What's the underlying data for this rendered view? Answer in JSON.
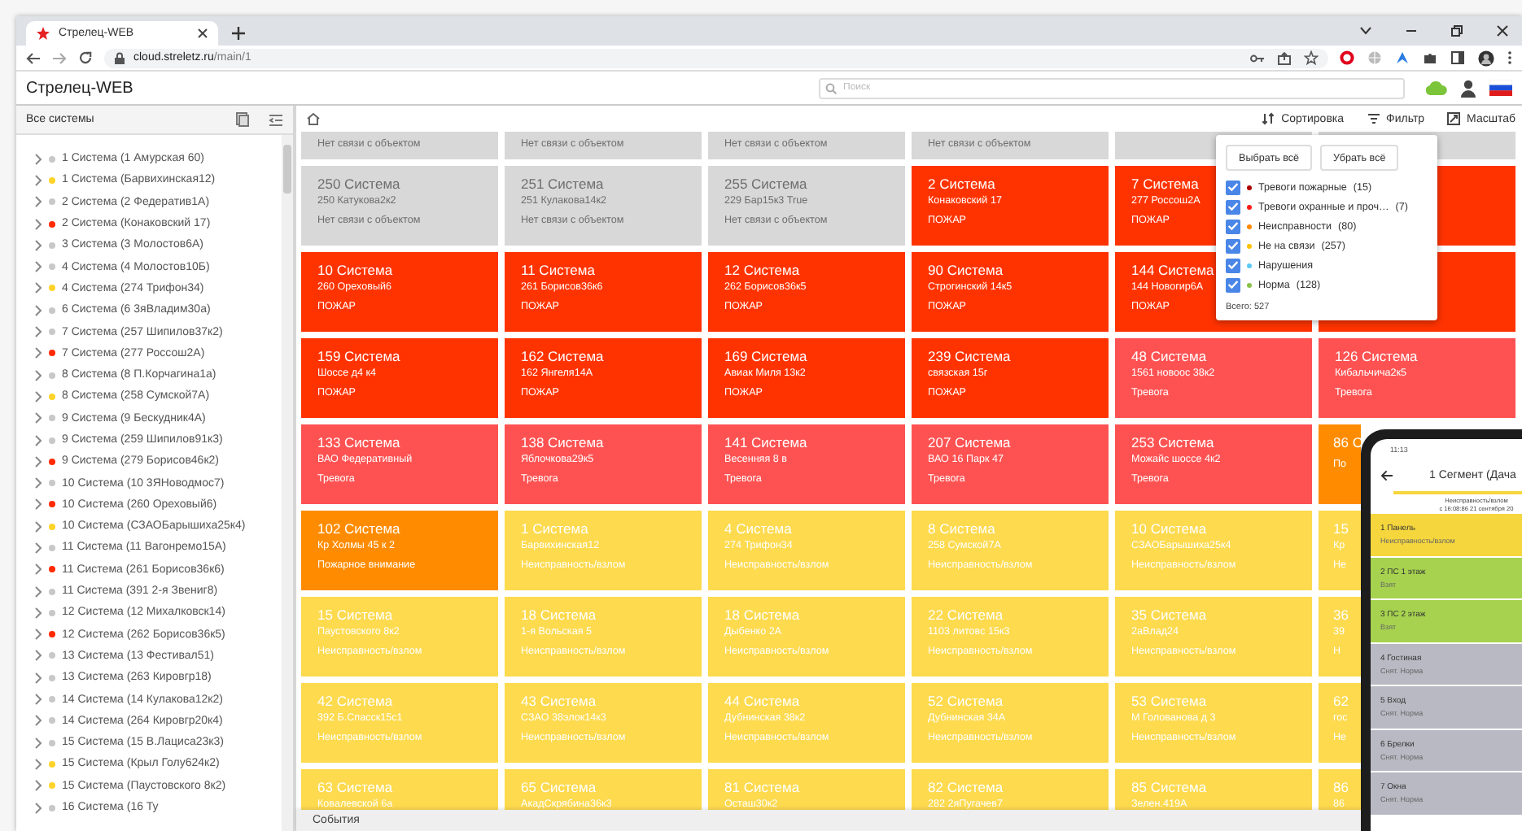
{
  "browser": {
    "tab_title": "Стрелец-WEB",
    "url_host": "cloud.streletz.ru",
    "url_path": "/main/1"
  },
  "app": {
    "title": "Стрелец-WEB",
    "search": {
      "placeholder": "Поиск"
    }
  },
  "sidebar": {
    "title": "Все системы",
    "items": [
      {
        "label": "1 Система (1 Амурская 60)",
        "color": "#c8c8c8"
      },
      {
        "label": "1 Система (Барвихинская12)",
        "color": "#ffd42a"
      },
      {
        "label": "2 Система (2 Федератив1А)",
        "color": "#c8c8c8"
      },
      {
        "label": "2 Система (Конаковский 17)",
        "color": "#ff2a00"
      },
      {
        "label": "3 Система (3 Молостов6А)",
        "color": "#c8c8c8"
      },
      {
        "label": "4 Система (4 Молостов10Б)",
        "color": "#c8c8c8"
      },
      {
        "label": "4 Система (274 Трифон34)",
        "color": "#ffd42a"
      },
      {
        "label": "6 Система (6 3яВладим30а)",
        "color": "#c8c8c8"
      },
      {
        "label": "7 Система (257 Шипилов37к2)",
        "color": "#c8c8c8"
      },
      {
        "label": "7 Система (277 Россош2А)",
        "color": "#ff2a00"
      },
      {
        "label": "8 Система (8 П.Корчагина1а)",
        "color": "#c8c8c8"
      },
      {
        "label": "8 Система (258 Сумской7А)",
        "color": "#ffd42a"
      },
      {
        "label": "9 Система (9 Бескудник4А)",
        "color": "#c8c8c8"
      },
      {
        "label": "9 Система (259 Шипилов91к3)",
        "color": "#c8c8c8"
      },
      {
        "label": "9 Система (279 Борисов46к2)",
        "color": "#ff2a00"
      },
      {
        "label": "10 Система (10 3ЯНоводмос7)",
        "color": "#c8c8c8"
      },
      {
        "label": "10 Система (260 Ореховый6)",
        "color": "#ff2a00"
      },
      {
        "label": "10 Система (СЗАОБарышиха25к4)",
        "color": "#ffd42a"
      },
      {
        "label": "11 Система (11 Вагонремо15А)",
        "color": "#c8c8c8"
      },
      {
        "label": "11 Система (261 Борисов36к6)",
        "color": "#ff2a00"
      },
      {
        "label": "11 Система (391 2-я Звениг8)",
        "color": "#c8c8c8"
      },
      {
        "label": "12 Система (12 Михалковск14)",
        "color": "#c8c8c8"
      },
      {
        "label": "12 Система (262 Борисов36к5)",
        "color": "#ff2a00"
      },
      {
        "label": "13 Система (13 Фестивал51)",
        "color": "#c8c8c8"
      },
      {
        "label": "13 Система (263 Кировгр18)",
        "color": "#c8c8c8"
      },
      {
        "label": "14 Система (14 Кулакова12к2)",
        "color": "#c8c8c8"
      },
      {
        "label": "14 Система (264 Кировгр20к4)",
        "color": "#c8c8c8"
      },
      {
        "label": "15 Система (15 В.Лациса23к3)",
        "color": "#c8c8c8"
      },
      {
        "label": "15 Система (Крыл Голу624к2)",
        "color": "#ffd42a"
      },
      {
        "label": "15 Система (Паустовского 8к2)",
        "color": "#ffd42a"
      },
      {
        "label": "16 Система (16 Ту",
        "color": "#c8c8c8"
      }
    ]
  },
  "toolbar": {
    "buttons": [
      {
        "kind": "sort",
        "label": "Сортировка"
      },
      {
        "kind": "filter",
        "label": "Фильтр"
      },
      {
        "kind": "scale",
        "label": "Масштаб"
      }
    ]
  },
  "tiles": [
    [
      {
        "kind": "offline",
        "status": "Нет связи с объектом"
      },
      {
        "kind": "offline",
        "status": "Нет связи с объектом"
      },
      {
        "kind": "offline",
        "status": "Нет связи с объектом"
      },
      {
        "kind": "offline",
        "status": "Нет связи с объектом"
      },
      {
        "kind": "offline"
      },
      {
        "kind": "offline"
      }
    ],
    [
      {
        "kind": "offline",
        "title": "250 Система",
        "address": "250 Катукова2к2",
        "status": "Нет связи с объектом"
      },
      {
        "kind": "offline",
        "title": "251 Система",
        "address": "251 Кулакова14к2",
        "status": "Нет связи с объектом"
      },
      {
        "kind": "offline",
        "title": "255 Система",
        "address": "229 Бар15к3 True",
        "status": "Нет связи с объектом"
      },
      {
        "kind": "fire",
        "title": "2 Система",
        "address": "Конаковский 17",
        "status": "ПОЖАР"
      },
      {
        "kind": "fire",
        "title": "7 Система",
        "address": "277 Россош2А",
        "status": "ПОЖАР"
      },
      {
        "kind": "fire"
      }
    ],
    [
      {
        "kind": "fire",
        "title": "10 Система",
        "address": "260 Ореховый6",
        "status": "ПОЖАР"
      },
      {
        "kind": "fire",
        "title": "11 Система",
        "address": "261 Борисов36к6",
        "status": "ПОЖАР"
      },
      {
        "kind": "fire",
        "title": "12 Система",
        "address": "262 Борисов36к5",
        "status": "ПОЖАР"
      },
      {
        "kind": "fire",
        "title": "90 Система",
        "address": "Строгинский 14к5",
        "status": "ПОЖАР"
      },
      {
        "kind": "fire",
        "title": "144 Система",
        "address": "144 Новогир6А",
        "status": "ПОЖАР"
      },
      {
        "kind": "fire"
      }
    ],
    [
      {
        "kind": "fire",
        "title": "159 Система",
        "address": "Шоссе д4 к4",
        "status": "ПОЖАР"
      },
      {
        "kind": "fire",
        "title": "162 Система",
        "address": "162 Янгеля14А",
        "status": "ПОЖАР"
      },
      {
        "kind": "fire",
        "title": "169 Система",
        "address": "Авиак Миля 13к2",
        "status": "ПОЖАР"
      },
      {
        "kind": "fire",
        "title": "239 Система",
        "address": "связская 15г",
        "status": "ПОЖАР"
      },
      {
        "kind": "alarm",
        "title": "48 Система",
        "address": "1561 новоос 38к2",
        "status": "Тревога"
      },
      {
        "kind": "alarm",
        "title": "126 Система",
        "address": "Кибальчича2к5",
        "status": "Тревога"
      }
    ],
    [
      {
        "kind": "alarm",
        "title": "133 Система",
        "address": "ВАО Федеративный",
        "status": "Тревога"
      },
      {
        "kind": "alarm",
        "title": "138 Система",
        "address": "Яблочкова29к5",
        "status": "Тревога"
      },
      {
        "kind": "alarm",
        "title": "141 Система",
        "address": "Весенняя 8 в",
        "status": "Тревога"
      },
      {
        "kind": "alarm",
        "title": "207 Система",
        "address": "ВАО 16 Парк 47",
        "status": "Тревога"
      },
      {
        "kind": "alarm",
        "title": "253 Система",
        "address": "Можайс шоссе 4к2",
        "status": "Тревога"
      },
      {
        "kind": "attention",
        "title": "86 С",
        "status": "По"
      }
    ],
    [
      {
        "kind": "attention",
        "title": "102 Система",
        "address": "Кр Холмы 45 к 2",
        "status": "Пожарное внимание"
      },
      {
        "kind": "fault",
        "title": "1 Система",
        "address": "Барвихинская12",
        "status": "Неисправность/взлом"
      },
      {
        "kind": "fault",
        "title": "4 Система",
        "address": "274 Трифон34",
        "status": "Неисправность/взлом"
      },
      {
        "kind": "fault",
        "title": "8 Система",
        "address": "258 Сумской7А",
        "status": "Неисправность/взлом"
      },
      {
        "kind": "fault",
        "title": "10 Система",
        "address": "СЗАОБарышиха25к4",
        "status": "Неисправность/взлом"
      },
      {
        "kind": "fault",
        "title": "15",
        "address": "Кр",
        "status": "Не"
      }
    ],
    [
      {
        "kind": "fault",
        "title": "15 Система",
        "address": "Паустовского 8к2",
        "status": "Неисправность/взлом"
      },
      {
        "kind": "fault",
        "title": "18 Система",
        "address": "1-я Вольская 5",
        "status": "Неисправность/взлом"
      },
      {
        "kind": "fault",
        "title": "18 Система",
        "address": "Дыбенко 2А",
        "status": "Неисправность/взлом"
      },
      {
        "kind": "fault",
        "title": "22 Система",
        "address": "1103 литовс 15к3",
        "status": "Неисправность/взлом"
      },
      {
        "kind": "fault",
        "title": "35 Система",
        "address": "2аВлад24",
        "status": "Неисправность/взлом"
      },
      {
        "kind": "fault",
        "title": "36",
        "address": "39",
        "status": "Н"
      }
    ],
    [
      {
        "kind": "fault",
        "title": "42 Система",
        "address": "392 Б.Спасск15с1",
        "status": "Неисправность/взлом"
      },
      {
        "kind": "fault",
        "title": "43 Система",
        "address": "СЗАО 38элок14к3",
        "status": "Неисправность/взлом"
      },
      {
        "kind": "fault",
        "title": "44 Система",
        "address": "Дубнинская 38к2",
        "status": "Неисправность/взлом"
      },
      {
        "kind": "fault",
        "title": "52 Система",
        "address": "Дубнинская 34А",
        "status": "Неисправность/взлом"
      },
      {
        "kind": "fault",
        "title": "53 Система",
        "address": "М Голованова д 3",
        "status": "Неисправность/взлом"
      },
      {
        "kind": "fault",
        "title": "62",
        "address": "гос",
        "status": "Не"
      }
    ],
    [
      {
        "kind": "fault",
        "title": "63 Система",
        "address": "Ковалевской 6а"
      },
      {
        "kind": "fault",
        "title": "65 Система",
        "address": "АкадСкрябина36к3"
      },
      {
        "kind": "fault",
        "title": "81 Система",
        "address": "Осташ30к2"
      },
      {
        "kind": "fault",
        "title": "82 Система",
        "address": "282 2яПугачев7"
      },
      {
        "kind": "fault",
        "title": "85 Система",
        "address": "Зелен.419А"
      },
      {
        "kind": "fault",
        "title": "86",
        "address": "86"
      }
    ]
  ],
  "filter_menu": {
    "buttons": [
      "Выбрать всё",
      "Убрать всё"
    ],
    "items": [
      {
        "label": "Тревоги пожарные",
        "count": "(15)",
        "color": "#b00000",
        "checked": true
      },
      {
        "label": "Тревоги охранные и проч…",
        "count": "(7)",
        "color": "#ff1a1a",
        "checked": true
      },
      {
        "label": "Неисправности",
        "count": "(80)",
        "color": "#ff8a00",
        "checked": true
      },
      {
        "label": "Не на связи",
        "count": "(257)",
        "color": "#ffc107",
        "checked": true
      },
      {
        "label": "Нарушения",
        "color": "#5bc8f5",
        "checked": true
      },
      {
        "label": "Норма",
        "count": "(128)",
        "color": "#8bc34a",
        "checked": true
      }
    ],
    "total": "Всего: 527"
  },
  "events_bar": {
    "label": "События"
  },
  "phone": {
    "time": "11:13",
    "title": "1 Сегмент (Дача",
    "status": "Неисправность/взлом",
    "since": "с 16:08:86 21 сентября 20",
    "zones": [
      {
        "kind": "fault",
        "name": "1 Панель",
        "state": "Неисправность/взлом"
      },
      {
        "kind": "armed",
        "name": "2 ПС 1 этаж",
        "state": "Взят"
      },
      {
        "kind": "armed",
        "name": "3 ПС 2 этаж",
        "state": "Взят"
      },
      {
        "kind": "disarmed",
        "name": "4 Гостиная",
        "state": "Снят. Норма"
      },
      {
        "kind": "disarmed",
        "name": "5 Вход",
        "state": "Снят. Норма"
      },
      {
        "kind": "disarmed",
        "name": "6 Брелки",
        "state": "Снят. Норма"
      },
      {
        "kind": "disarmed",
        "name": "7 Окна",
        "state": "Снят. Норма"
      }
    ]
  }
}
